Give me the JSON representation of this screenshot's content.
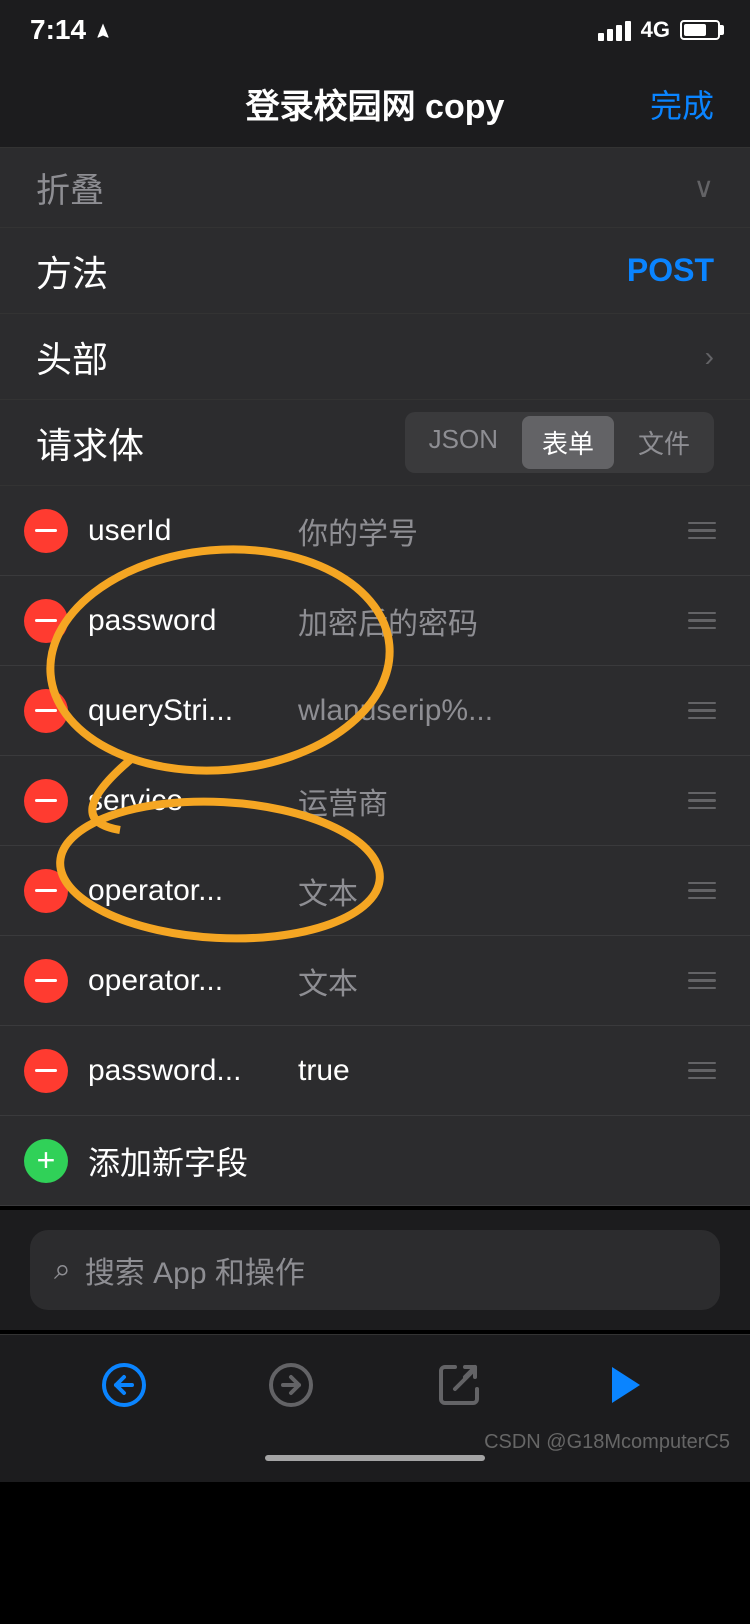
{
  "status": {
    "time": "7:14",
    "network": "4G",
    "location_icon": "arrow-up-right-icon"
  },
  "nav": {
    "title": "登录校园网 copy",
    "done_label": "完成"
  },
  "fold_section": {
    "label": "折叠",
    "icon": "chevron-down-icon"
  },
  "method_section": {
    "label": "方法",
    "value": "POST"
  },
  "header_section": {
    "label": "头部",
    "icon": "chevron-right-icon"
  },
  "request_body": {
    "label": "请求体",
    "tabs": [
      {
        "label": "JSON",
        "active": false
      },
      {
        "label": "表单",
        "active": true
      },
      {
        "label": "文件",
        "active": false
      }
    ]
  },
  "fields": [
    {
      "name": "userId",
      "value": "你的学号",
      "minus_label": "minus",
      "drag_label": "drag"
    },
    {
      "name": "password",
      "value": "加密后的密码",
      "minus_label": "minus",
      "drag_label": "drag"
    },
    {
      "name": "queryStri...",
      "value": "wlanuserip%...",
      "minus_label": "minus",
      "drag_label": "drag"
    },
    {
      "name": "service",
      "value": "运营商",
      "minus_label": "minus",
      "drag_label": "drag"
    },
    {
      "name": "operator...",
      "value": "文本",
      "minus_label": "minus",
      "drag_label": "drag"
    },
    {
      "name": "operator...",
      "value": "文本",
      "minus_label": "minus",
      "drag_label": "drag"
    },
    {
      "name": "password...",
      "value": "true",
      "minus_label": "minus",
      "drag_label": "drag"
    }
  ],
  "add_field": {
    "label": "添加新字段"
  },
  "search": {
    "placeholder": "搜索 App 和操作"
  },
  "toolbar": {
    "back_label": "back",
    "forward_label": "forward",
    "share_label": "share",
    "play_label": "play"
  },
  "watermark": "CSDN @G18McomputerC5",
  "colors": {
    "accent_blue": "#0a84ff",
    "minus_red": "#ff3b30",
    "plus_green": "#30d158",
    "background": "#1c1c1e",
    "cell_bg": "#2c2c2e",
    "separator": "#3a3a3c",
    "text_primary": "#ffffff",
    "text_secondary": "#8e8e93"
  }
}
